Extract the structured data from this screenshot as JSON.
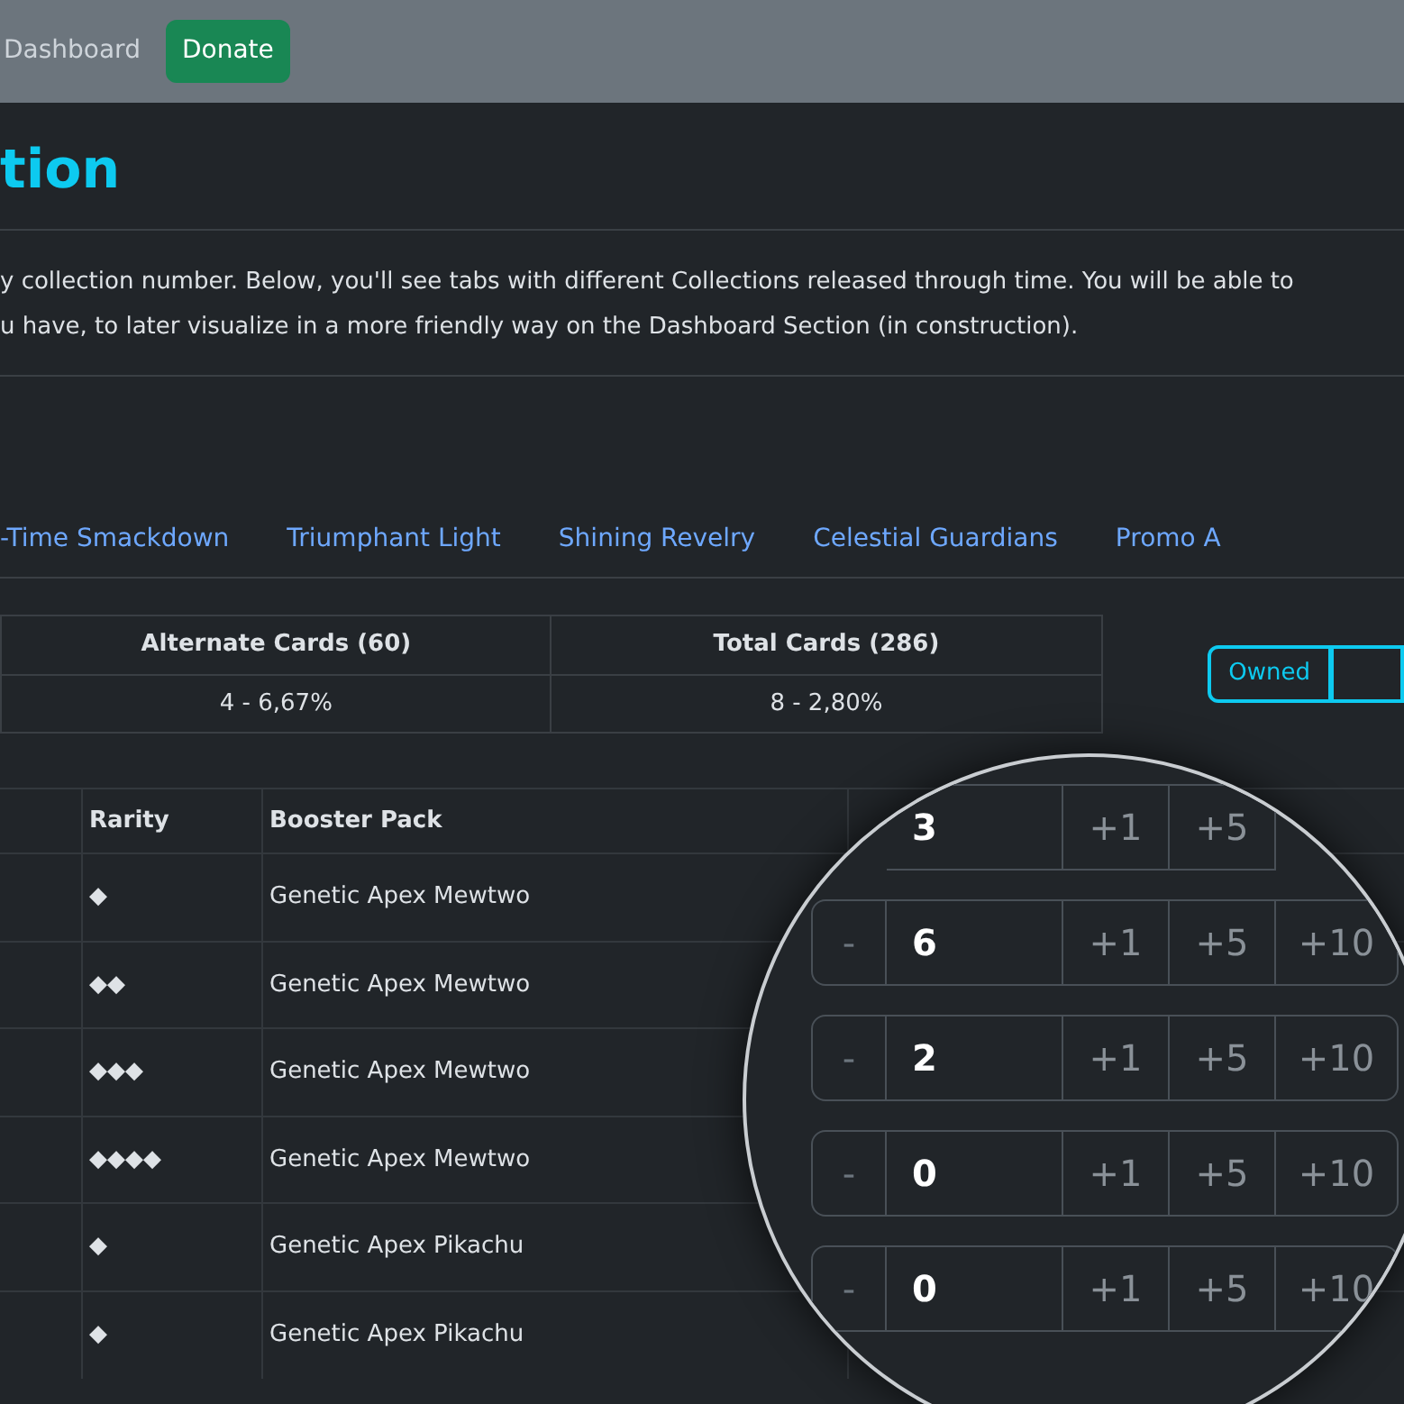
{
  "navbar": {
    "links": [
      {
        "label": "Dashboard"
      }
    ],
    "donate_button": "Donate"
  },
  "page_title": "tion",
  "intro": [
    "y collection number. Below, you'll see tabs with different Collections released through time. You will be able to",
    "u have, to later visualize in a more friendly way on the Dashboard Section (in construction)."
  ],
  "tabs": [
    {
      "label": "-Time Smackdown",
      "selected": false
    },
    {
      "label": "Triumphant Light",
      "selected": false
    },
    {
      "label": "Shining Revelry",
      "selected": false
    },
    {
      "label": "Celestial Guardians",
      "selected": false
    },
    {
      "label": "Promo A",
      "selected": false
    }
  ],
  "stats": [
    {
      "heading": "Alternate Cards (60)",
      "value": "4 - 6,67%"
    },
    {
      "heading": "Total Cards (286)",
      "value": "8 - 2,80%"
    }
  ],
  "filter_buttons": [
    {
      "label": "Owned",
      "selected": false
    },
    {
      "selected": false
    }
  ],
  "table": {
    "columns": [
      "Rarity",
      "Booster Pack"
    ],
    "rows": [
      {
        "rarity": "◆",
        "booster_pack": "Genetic Apex Mewtwo"
      },
      {
        "rarity": "◆◆",
        "booster_pack": "Genetic Apex Mewtwo"
      },
      {
        "rarity": "◆◆◆",
        "booster_pack": "Genetic Apex Mewtwo"
      },
      {
        "rarity": "◆◆◆◆",
        "booster_pack": "Genetic Apex Mewtwo"
      },
      {
        "rarity": "◆",
        "booster_pack": "Genetic Apex Pikachu"
      },
      {
        "rarity": "◆",
        "booster_pack": "Genetic Apex Pikachu"
      }
    ]
  },
  "magnifier": {
    "rows": [
      {
        "value": "3",
        "steps": [
          "+1",
          "+5"
        ]
      },
      {
        "minus": "-",
        "value": "6",
        "steps": [
          "+1",
          "+5",
          "+10"
        ]
      },
      {
        "minus": "-",
        "value": "2",
        "steps": [
          "+1",
          "+5",
          "+10"
        ]
      },
      {
        "minus": "-",
        "value": "0",
        "steps": [
          "+1",
          "+5",
          "+10"
        ]
      },
      {
        "minus": "-",
        "value": "0",
        "steps": [
          "+1",
          "+5",
          "+10"
        ]
      }
    ]
  }
}
